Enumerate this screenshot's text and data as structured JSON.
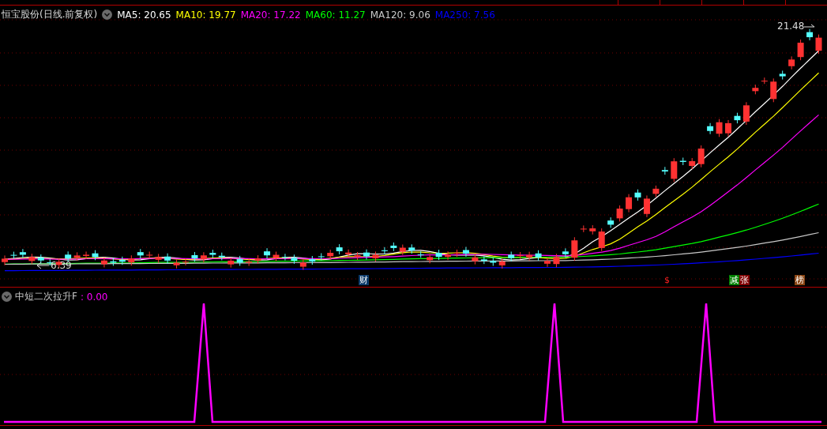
{
  "chart": {
    "title": "恒宝股份(日线.前复权)",
    "moving_averages": [
      {
        "label": "MA5: 20.65",
        "color": "#ffffff"
      },
      {
        "label": "MA10: 19.77",
        "color": "#ffff00"
      },
      {
        "label": "MA20: 17.22",
        "color": "#ff00ff"
      },
      {
        "label": "MA60: 11.27",
        "color": "#00ff00"
      },
      {
        "label": "MA120: 9.06",
        "color": "#c8c8c8"
      },
      {
        "label": "MA250: 7.56",
        "color": "#0000ff"
      }
    ],
    "high_label": "21.48",
    "low_label": "6.39",
    "event_markers": [
      {
        "text": "财",
        "color": "#0a3a6a"
      },
      {
        "text": "$",
        "color": "#000000"
      },
      {
        "text": "减",
        "color": "#008000"
      },
      {
        "text": "张",
        "color": "#800000"
      },
      {
        "text": "榜",
        "color": "#8b4513"
      }
    ]
  },
  "indicator": {
    "name": "中短二次拉升F",
    "value": ": 0.00"
  }
}
